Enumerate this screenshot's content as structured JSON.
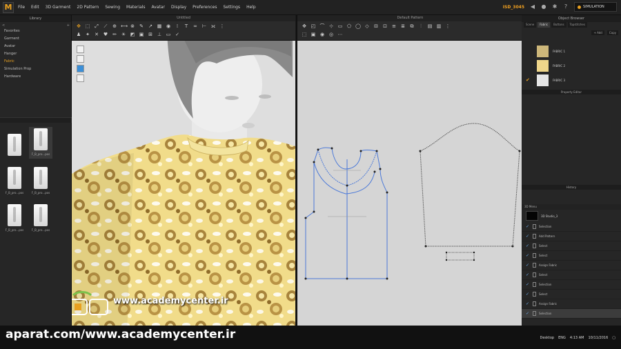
{
  "app": {
    "logo": "M",
    "menu": [
      "File",
      "Edit",
      "3D Garment",
      "2D Pattern",
      "Sewing",
      "Materials",
      "Avatar",
      "Display",
      "Preferences",
      "Settings",
      "Help"
    ],
    "points": "ISD_3045",
    "simulation_label": "SIMULATION"
  },
  "library": {
    "title": "Library",
    "nav_back": "<",
    "nav_home": "+",
    "items": [
      "Favorites",
      "Garment",
      "Avatar",
      "Hanger",
      "Fabric",
      "Simulation Prop",
      "Hardware"
    ],
    "active_index": 4,
    "thumbnails": [
      {
        "caption": ""
      },
      {
        "caption": "F_B_pro...pos"
      },
      {
        "caption": "F_B_pro...pos"
      },
      {
        "caption": "F_B_pro...pos"
      },
      {
        "caption": "F_B_pro...pos"
      },
      {
        "caption": "F_B_pro...pos"
      }
    ],
    "selected_thumb": 1
  },
  "view3d": {
    "title": "Untitled",
    "watermark": "www.academycenter.ir"
  },
  "view2d": {
    "title": "Default Pattern"
  },
  "object_browser": {
    "title": "Object Browser",
    "tabs": [
      "Scene",
      "Fabric",
      "Buttons",
      "Topstitches"
    ],
    "active_tab": 1,
    "add_label": "+ Add",
    "copy_label": "Copy",
    "fabrics": [
      {
        "label": "FABRIC 1",
        "color": "#cdb77a",
        "checked": ""
      },
      {
        "label": "FABRIC 2",
        "color": "#efd68a",
        "checked": ""
      },
      {
        "label": "FABRIC 3",
        "color": "#e6e6e6",
        "checked": "✔"
      }
    ],
    "property_editor": "Property Editor",
    "history_title": "History",
    "history_list_title": "3D Menu",
    "history_object": "3D Studio_3",
    "history_rows": [
      "Selection",
      "Add Pattern",
      "Select",
      "Select",
      "Assign Fabric",
      "Select",
      "Selection",
      "Select",
      "Assign Fabric",
      "Selection"
    ],
    "history_selected": 9
  },
  "taskbar": {
    "watermark": "aparat.com/www.academycenter.ir",
    "desktop": "Desktop",
    "lang": "ENG",
    "time": "4:13 AM",
    "date": "10/11/2016"
  },
  "colors": {
    "accent": "#e8a020",
    "pattern_line": "#4a78d8",
    "viewport_bg": "#d5d5d5"
  }
}
